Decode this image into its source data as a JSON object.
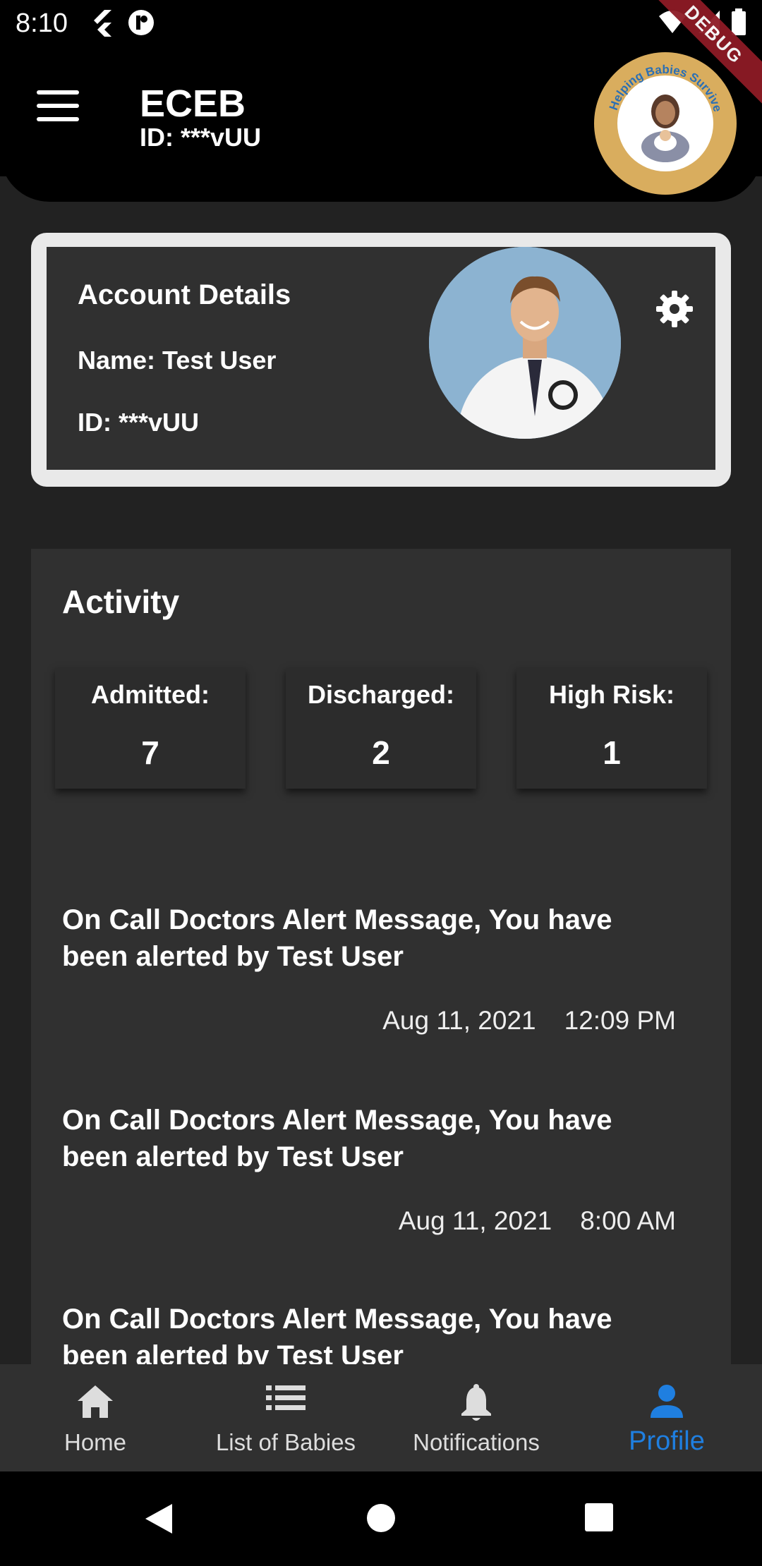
{
  "status_bar": {
    "time": "8:10",
    "debug_label": "DEBUG"
  },
  "app_bar": {
    "title": "ECEB",
    "subtitle": "ID: ***vUU",
    "logo_text": "Helping Babies Survive"
  },
  "account": {
    "title": "Account Details",
    "name": "Name: Test User",
    "id": "ID: ***vUU"
  },
  "activity": {
    "title": "Activity",
    "stats": [
      {
        "label": "Admitted:",
        "value": "7"
      },
      {
        "label": "Discharged:",
        "value": "2"
      },
      {
        "label": "High Risk:",
        "value": "1"
      }
    ],
    "alerts": [
      {
        "message": "On Call Doctors Alert Message, You have been alerted by Test User",
        "date": "Aug 11, 2021",
        "time": "12:09 PM"
      },
      {
        "message": "On Call Doctors Alert Message, You have been alerted by Test User",
        "date": "Aug 11, 2021",
        "time": "8:00 AM"
      },
      {
        "message": "On Call Doctors Alert Message, You have been alerted by Test User",
        "date": "",
        "time": ""
      }
    ]
  },
  "bottom_nav": {
    "items": [
      {
        "label": "Home",
        "icon": "home-icon"
      },
      {
        "label": "List of Babies",
        "icon": "list-icon"
      },
      {
        "label": "Notifications",
        "icon": "bell-icon"
      },
      {
        "label": "Profile",
        "icon": "person-icon",
        "active": true
      }
    ]
  },
  "colors": {
    "accent": "#1f7fe0",
    "background": "#222222",
    "card": "#303030",
    "logo_ring": "#d9ad5e",
    "debug_ribbon": "#8e1b25"
  }
}
